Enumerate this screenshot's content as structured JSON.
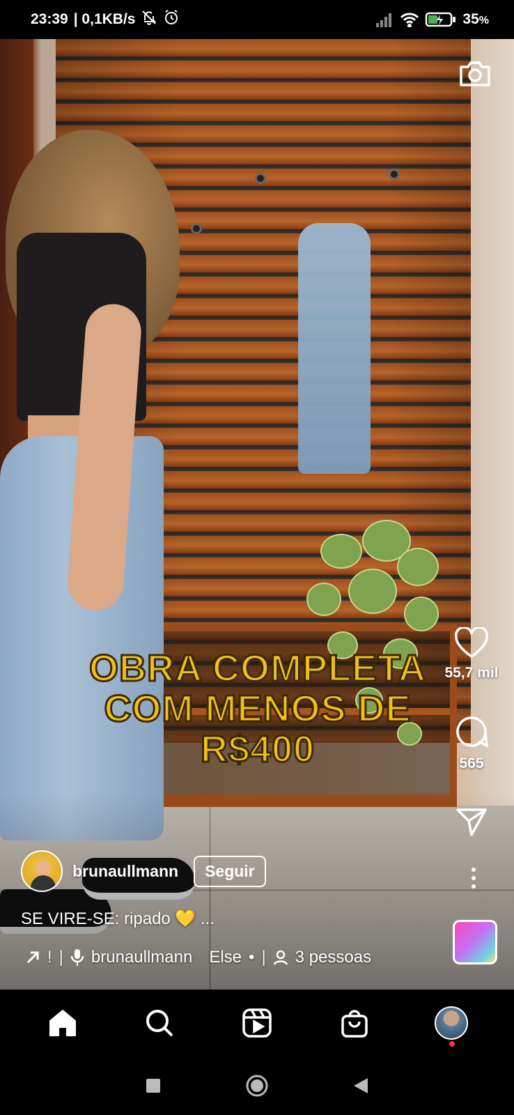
{
  "status_bar": {
    "time": "23:39",
    "network_speed": "| 0,1KB/s",
    "battery": "35",
    "battery_unit": "%",
    "icons": [
      "mute-icon",
      "alarm-icon",
      "signal-icon",
      "wifi-icon",
      "battery-icon"
    ]
  },
  "video": {
    "overlay_text": "OBRA COMPLETA COM MENOS DE R$400"
  },
  "actions": {
    "likes": "55,7 mil",
    "comments": "565"
  },
  "author": {
    "username": "brunaullmann",
    "follow_label": "Seguir"
  },
  "post": {
    "caption": "SE VIRE-SE: ripado 💛 ..."
  },
  "audio": {
    "prefix": "!",
    "artist": "brunaullmann",
    "track": "Else",
    "separator": "•",
    "people": "3 pessoas"
  },
  "colors": {
    "overlay_text": "#f2c018",
    "notification": "#ff3040",
    "background": "#000000"
  },
  "nav": {
    "items": [
      "home-icon",
      "search-icon",
      "reels-icon",
      "shop-icon",
      "profile-avatar"
    ]
  }
}
